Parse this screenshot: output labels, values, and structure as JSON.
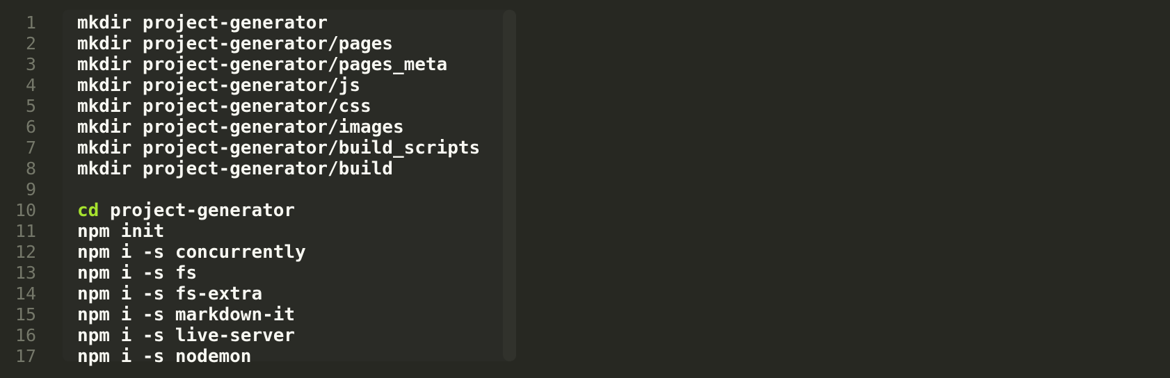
{
  "gutter": {
    "line_numbers": [
      "1",
      "2",
      "3",
      "4",
      "5",
      "6",
      "7",
      "8",
      "9",
      "10",
      "11",
      "12",
      "13",
      "14",
      "15",
      "16",
      "17"
    ]
  },
  "code": {
    "lines": [
      {
        "keyword": "",
        "text": "mkdir project-generator"
      },
      {
        "keyword": "",
        "text": "mkdir project-generator/pages"
      },
      {
        "keyword": "",
        "text": "mkdir project-generator/pages_meta"
      },
      {
        "keyword": "",
        "text": "mkdir project-generator/js"
      },
      {
        "keyword": "",
        "text": "mkdir project-generator/css"
      },
      {
        "keyword": "",
        "text": "mkdir project-generator/images"
      },
      {
        "keyword": "",
        "text": "mkdir project-generator/build_scripts"
      },
      {
        "keyword": "",
        "text": "mkdir project-generator/build"
      },
      {
        "keyword": "",
        "text": ""
      },
      {
        "keyword": "cd",
        "text": " project-generator"
      },
      {
        "keyword": "",
        "text": "npm init"
      },
      {
        "keyword": "",
        "text": "npm i -s concurrently"
      },
      {
        "keyword": "",
        "text": "npm i -s fs"
      },
      {
        "keyword": "",
        "text": "npm i -s fs-extra"
      },
      {
        "keyword": "",
        "text": "npm i -s markdown-it"
      },
      {
        "keyword": "",
        "text": "npm i -s live-server"
      },
      {
        "keyword": "",
        "text": "npm i -s nodemon"
      }
    ]
  },
  "colors": {
    "background": "#272822",
    "text": "#f8f8f2",
    "keyword": "#a6e22e",
    "line_number": "#75786a"
  }
}
